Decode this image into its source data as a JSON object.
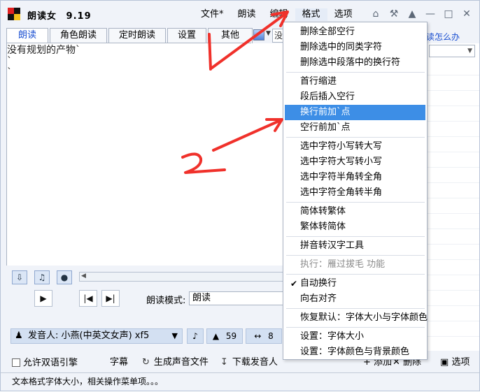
{
  "app": {
    "title": "朗读女",
    "version": "9.19"
  },
  "menubar": [
    {
      "label": "文件*",
      "active": false
    },
    {
      "label": "朗读",
      "active": false
    },
    {
      "label": "编辑",
      "active": false
    },
    {
      "label": "格式",
      "active": true
    },
    {
      "label": "选项",
      "active": false
    }
  ],
  "title_icons": [
    "home-icon",
    "tools-icon",
    "shirt-icon",
    "minimize-icon",
    "maximize-icon",
    "close-icon"
  ],
  "tabs": [
    {
      "label": "朗读",
      "selected": true
    },
    {
      "label": "角色朗读",
      "selected": false
    },
    {
      "label": "定时朗读",
      "selected": false
    },
    {
      "label": "设置",
      "selected": false
    },
    {
      "label": "其他",
      "selected": false
    }
  ],
  "toolbar": {
    "find_partial": "没",
    "help_link": "读怎么办"
  },
  "editor": {
    "lines": [
      "没有规划的产物`",
      "`",
      "`"
    ]
  },
  "format_menu": {
    "items": [
      {
        "label": "删除全部空行",
        "type": "item"
      },
      {
        "label": "删除选中的同类字符",
        "type": "item"
      },
      {
        "label": "删除选中段落中的换行符",
        "type": "item"
      },
      {
        "type": "sep"
      },
      {
        "label": "首行缩进",
        "type": "item"
      },
      {
        "label": "段后插入空行",
        "type": "item"
      },
      {
        "label": "换行前加`点",
        "type": "item",
        "highlighted": true
      },
      {
        "label": "空行前加`点",
        "type": "item"
      },
      {
        "type": "sep"
      },
      {
        "label": "选中字符小写转大写",
        "type": "item"
      },
      {
        "label": "选中字符大写转小写",
        "type": "item"
      },
      {
        "label": "选中字符半角转全角",
        "type": "item"
      },
      {
        "label": "选中字符全角转半角",
        "type": "item"
      },
      {
        "type": "sep"
      },
      {
        "label": "简体转繁体",
        "type": "item"
      },
      {
        "label": "繁体转简体",
        "type": "item"
      },
      {
        "type": "sep"
      },
      {
        "label": "拼音转汉字工具",
        "type": "item"
      },
      {
        "type": "sep"
      },
      {
        "label": "执行：雁过拔毛 功能",
        "type": "item",
        "disabled": true
      },
      {
        "type": "sep"
      },
      {
        "label": "自动换行",
        "type": "item",
        "checked": true
      },
      {
        "label": "向右对齐",
        "type": "item"
      },
      {
        "type": "sep"
      },
      {
        "label": "恢复默认：字体大小与字体颜色",
        "type": "item"
      },
      {
        "type": "sep"
      },
      {
        "label": "设置：字体大小",
        "type": "item"
      },
      {
        "label": "设置：字体颜色与背景颜色",
        "type": "item"
      }
    ]
  },
  "player": {
    "mode_label": "朗读模式:",
    "mode_value": "朗读",
    "speaker_label": "发音人: 小燕(中英文女声) xf5",
    "volume": "59",
    "speed": "8"
  },
  "bottom": {
    "bilingual_label": "允许双语引擎",
    "subtitle_label": "字幕",
    "gen_audio_label": "生成声音文件",
    "download_label": "下载发音人",
    "add_label": "添加",
    "delete_label": "删除",
    "options_label": "选项"
  },
  "status_text": "文本格式字体大小，相关操作菜单项。。。",
  "colors": {
    "highlight": "#3d8ee6",
    "tab_selected_text": "#1a4fd1",
    "annotation_red": "#f0312b"
  }
}
